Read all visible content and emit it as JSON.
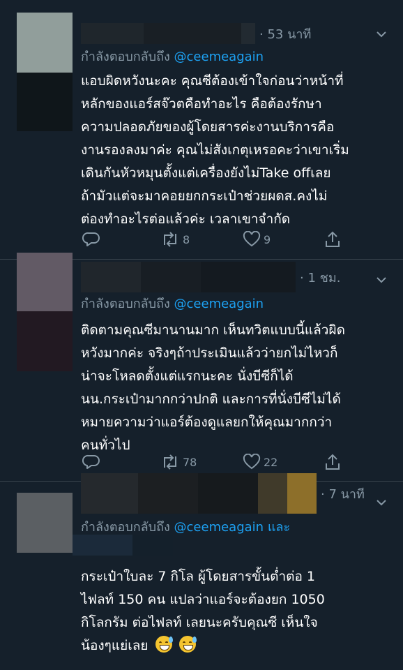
{
  "colors": {
    "background": "#15202b",
    "secondary": "#8899a6",
    "link": "#1da1f2",
    "divider": "#38444d"
  },
  "tweets": [
    {
      "time": "· 53 นาที",
      "reply_prefix": "กำลังตอบกลับถึง",
      "reply_handle": "@ceemeagain",
      "reply_suffix": "",
      "lines": [
        "แอบผิดหวังนะคะ คุณซีต้องเข้าใจก่อนว่าหน้าที่",
        "หลักของแอร์สจ๊วตคือทำอะไร คือต้องรักษา",
        "ความปลอดภัยของผู้โดยสารค่ะงานบริการคือ",
        "งานรองลงมาค่ะ คุณไม่สังเกตุเหรอคะว่าเขาเริ่ม",
        "เดินกันหัวหมุนตั้งแต่เครื่องยังไม่Take offเลย",
        "ถ้ามัวแต่จะมาคอยยกกระเป๋าช่วยผดส.คงไม่",
        "ต่องทำอะไรต่อแล้วค่ะ เวลาเขาจำกัด"
      ],
      "retweets": "8",
      "likes": "9"
    },
    {
      "time": "· 1 ชม.",
      "reply_prefix": "กำลังตอบกลับถึง",
      "reply_handle": "@ceemeagain",
      "reply_suffix": "",
      "lines": [
        "ติดตามคุณซีมานานมาก เห็นทวิตแบบนี้แล้วผิด",
        "หวังมากค่ะ จริงๆถ้าประเมินแล้วว่ายกไม่ไหวก็",
        "น่าจะโหลดตั้งแต่แรกนะคะ นั่งบีซีก็ได้",
        "นน.กระเป๋ามากกว่าปกติ และการที่นั่งบีซีไม่ได้",
        "หมายความว่าแอร์ต้องดูแลยกให้คุณมากกว่า",
        "คนทั่วไป"
      ],
      "retweets": "78",
      "likes": "22"
    },
    {
      "time": "· 7 นาที",
      "reply_prefix": "กำลังตอบกลับถึง",
      "reply_handle": "@ceemeagain",
      "reply_suffix": "และ",
      "lines": [
        "กระเป๋าใบละ 7 กิโล ผู้โดยสารขั้นต่ำต่อ 1",
        "ไฟลท์ 150 คน แปลว่าแอร์จะต้องยก 1050",
        "กิโลกรัม ต่อไฟลท์ เลยนะครับคุณซี เห็นใจ",
        "น้องๆแย่เลย"
      ],
      "emojis": [
        "grinning-face-with-sweat",
        "grinning-face-with-sweat"
      ]
    }
  ]
}
